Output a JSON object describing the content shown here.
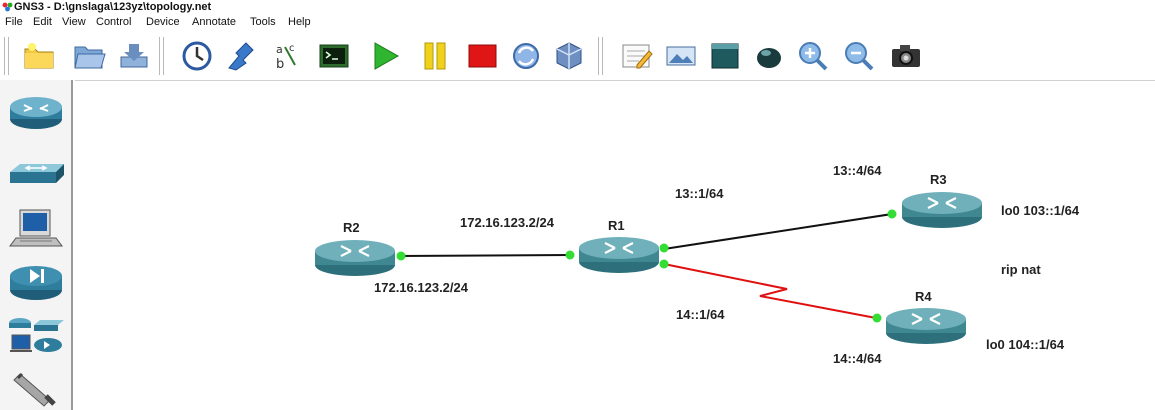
{
  "window": {
    "title": "GNS3 - D:\\gnslaga\\123yz\\topology.net"
  },
  "menu": [
    "File",
    "Edit",
    "View",
    "Control",
    "Device",
    "Annotate",
    "Tools",
    "Help"
  ],
  "topology": {
    "nodes": {
      "r1": "R1",
      "r2": "R2",
      "r3": "R3",
      "r4": "R4"
    },
    "labels": {
      "r1_r2_upper": "172.16.123.2/24",
      "r2_lower": "172.16.123.2/24",
      "r1_r3": "13::1/64",
      "r3_side": "13::4/64",
      "r3_loopback": "lo0 103::1/64",
      "r1_r4": "14::1/64",
      "r4_side": "14::4/64",
      "r4_loopback": "lo0 104::1/64",
      "note": "rip nat"
    },
    "colors": {
      "ethernet_link": "#111111",
      "serial_link": "#e01010",
      "port_up": "#33dd33"
    }
  }
}
